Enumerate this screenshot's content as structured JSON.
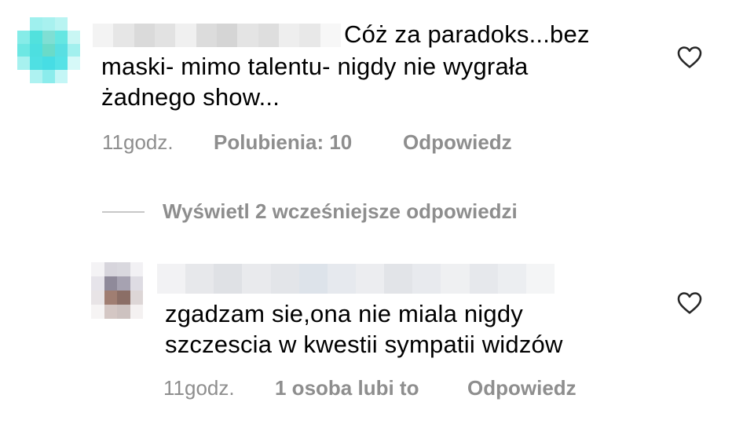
{
  "comments": [
    {
      "avatar": "blurred-avatar",
      "username": "",
      "text_lines": [
        "Cóż za paradoks...bez",
        "maski- mimo talentu- nigdy nie wygrała",
        "żadnego show..."
      ],
      "time": "11godz.",
      "likes": "Polubienia: 10",
      "reply": "Odpowiedz",
      "like_icon": "heart-outline-icon"
    },
    {
      "avatar": "blurred-avatar",
      "username": "",
      "text_lines": [
        "zgadzam sie,ona nie miala nigdy",
        "szczescia w kwestii sympatii widzów"
      ],
      "time": "11godz.",
      "likes": "1 osoba lubi to",
      "reply": "Odpowiedz",
      "like_icon": "heart-outline-icon"
    }
  ],
  "view_replies": "Wyświetl 2 wcześniejsze odpowiedzi",
  "colors": {
    "text": "#000000",
    "meta": "#8e8e8e",
    "divider": "#c7c7c7",
    "background": "#ffffff"
  }
}
